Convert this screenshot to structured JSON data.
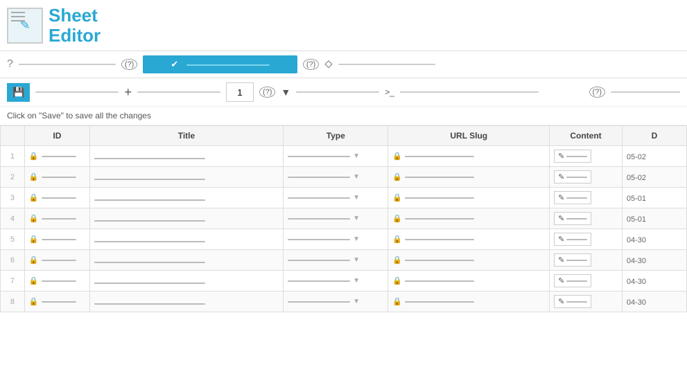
{
  "app": {
    "title_line1": "Sheet",
    "title_line2": "Editor"
  },
  "toolbar1": {
    "help_icon": "?",
    "help_badge1": "(?)",
    "help_badge2": "(?)",
    "check_btn": "✔",
    "arrow_icon": "⬦"
  },
  "toolbar2": {
    "save_icon": "💾",
    "plus_icon": "+",
    "num_value": "1",
    "help_badge": "(?)",
    "filter_icon": "▼",
    "code_icon": ">_"
  },
  "save_info_text": "Click on \"Save\" to save all the changes",
  "columns": [
    "ID",
    "Title",
    "Type",
    "URL Slug",
    "Content",
    "D"
  ],
  "rows": [
    {
      "num": 1,
      "date": "05-02"
    },
    {
      "num": 2,
      "date": "05-02"
    },
    {
      "num": 3,
      "date": "05-01"
    },
    {
      "num": 4,
      "date": "05-01"
    },
    {
      "num": 5,
      "date": "04-30"
    },
    {
      "num": 6,
      "date": "04-30"
    },
    {
      "num": 7,
      "date": "04-30"
    },
    {
      "num": 8,
      "date": "04-30"
    }
  ]
}
